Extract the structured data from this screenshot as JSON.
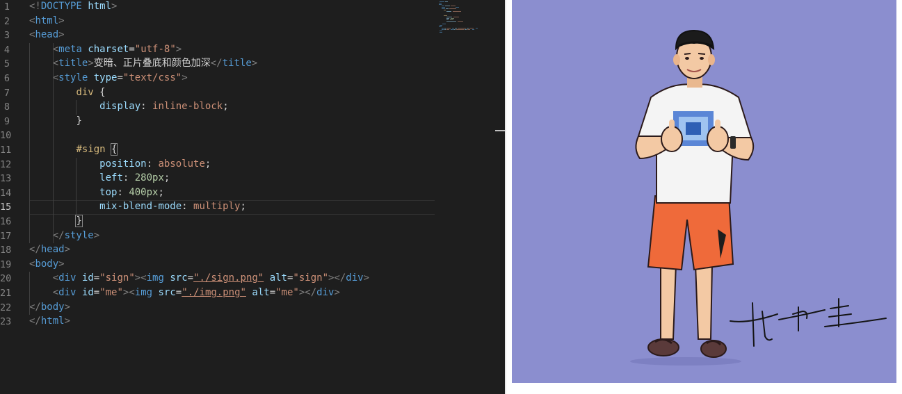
{
  "editor": {
    "active_line": 15,
    "line_numbers": [
      "1",
      "2",
      "3",
      "4",
      "5",
      "6",
      "7",
      "8",
      "9",
      "10",
      "11",
      "12",
      "13",
      "14",
      "15",
      "16",
      "17",
      "18",
      "19",
      "20",
      "21",
      "22",
      "23"
    ],
    "lines": [
      [
        [
          "t-punct",
          "<!"
        ],
        [
          "t-tag",
          "DOCTYPE"
        ],
        [
          "t-text",
          " "
        ],
        [
          "t-attr",
          "html"
        ],
        [
          "t-punct",
          ">"
        ]
      ],
      [
        [
          "t-punct",
          "<"
        ],
        [
          "t-tag",
          "html"
        ],
        [
          "t-punct",
          ">"
        ]
      ],
      [
        [
          "t-punct",
          "<"
        ],
        [
          "t-tag",
          "head"
        ],
        [
          "t-punct",
          ">"
        ]
      ],
      [
        [
          "t-text",
          "    "
        ],
        [
          "t-punct",
          "<"
        ],
        [
          "t-tag",
          "meta"
        ],
        [
          "t-text",
          " "
        ],
        [
          "t-attr",
          "charset"
        ],
        [
          "t-text",
          "="
        ],
        [
          "t-str",
          "\"utf-8\""
        ],
        [
          "t-punct",
          ">"
        ]
      ],
      [
        [
          "t-text",
          "    "
        ],
        [
          "t-punct",
          "<"
        ],
        [
          "t-tag",
          "title"
        ],
        [
          "t-punct",
          ">"
        ],
        [
          "t-text cjk",
          "变暗、正片叠底和颜色加深"
        ],
        [
          "t-punct",
          "</"
        ],
        [
          "t-tag",
          "title"
        ],
        [
          "t-punct",
          ">"
        ]
      ],
      [
        [
          "t-text",
          "    "
        ],
        [
          "t-punct",
          "<"
        ],
        [
          "t-tag",
          "style"
        ],
        [
          "t-text",
          " "
        ],
        [
          "t-attr",
          "type"
        ],
        [
          "t-text",
          "="
        ],
        [
          "t-str",
          "\"text/css\""
        ],
        [
          "t-punct",
          ">"
        ]
      ],
      [
        [
          "t-text",
          "        "
        ],
        [
          "t-sel",
          "div"
        ],
        [
          "t-brace",
          " {"
        ]
      ],
      [
        [
          "t-text",
          "            "
        ],
        [
          "t-prop",
          "display"
        ],
        [
          "t-text",
          ": "
        ],
        [
          "t-val",
          "inline-block"
        ],
        [
          "t-text",
          ";"
        ]
      ],
      [
        [
          "t-text",
          "        "
        ],
        [
          "t-brace",
          "}"
        ]
      ],
      [],
      [
        [
          "t-text",
          "        "
        ],
        [
          "t-sel",
          "#sign"
        ],
        [
          "t-text",
          " "
        ],
        [
          "t-brace bracket-match",
          "{"
        ]
      ],
      [
        [
          "t-text",
          "            "
        ],
        [
          "t-prop",
          "position"
        ],
        [
          "t-text",
          ": "
        ],
        [
          "t-val",
          "absolute"
        ],
        [
          "t-text",
          ";"
        ]
      ],
      [
        [
          "t-text",
          "            "
        ],
        [
          "t-prop",
          "left"
        ],
        [
          "t-text",
          ": "
        ],
        [
          "t-num",
          "280px"
        ],
        [
          "t-text",
          ";"
        ]
      ],
      [
        [
          "t-text",
          "            "
        ],
        [
          "t-prop",
          "top"
        ],
        [
          "t-text",
          ": "
        ],
        [
          "t-num",
          "400px"
        ],
        [
          "t-text",
          ";"
        ]
      ],
      [
        [
          "t-text",
          "            "
        ],
        [
          "t-prop",
          "mix-blend-mode"
        ],
        [
          "t-text",
          ": "
        ],
        [
          "t-val",
          "multiply"
        ],
        [
          "t-text",
          ";"
        ]
      ],
      [
        [
          "t-text",
          "        "
        ],
        [
          "t-brace bracket-match",
          "}"
        ]
      ],
      [
        [
          "t-text",
          "    "
        ],
        [
          "t-punct",
          "</"
        ],
        [
          "t-tag",
          "style"
        ],
        [
          "t-punct",
          ">"
        ]
      ],
      [
        [
          "t-punct",
          "</"
        ],
        [
          "t-tag",
          "head"
        ],
        [
          "t-punct",
          ">"
        ]
      ],
      [
        [
          "t-punct",
          "<"
        ],
        [
          "t-tag",
          "body"
        ],
        [
          "t-punct",
          ">"
        ]
      ],
      [
        [
          "t-text",
          "    "
        ],
        [
          "t-punct",
          "<"
        ],
        [
          "t-tag",
          "div"
        ],
        [
          "t-text",
          " "
        ],
        [
          "t-attr",
          "id"
        ],
        [
          "t-text",
          "="
        ],
        [
          "t-str",
          "\"sign\""
        ],
        [
          "t-punct",
          "><"
        ],
        [
          "t-tag",
          "img"
        ],
        [
          "t-text",
          " "
        ],
        [
          "t-attr",
          "src"
        ],
        [
          "t-text",
          "="
        ],
        [
          "t-str t-link",
          "\"./sign.png\""
        ],
        [
          "t-text",
          " "
        ],
        [
          "t-attr",
          "alt"
        ],
        [
          "t-text",
          "="
        ],
        [
          "t-str",
          "\"sign\""
        ],
        [
          "t-punct",
          "></"
        ],
        [
          "t-tag",
          "div"
        ],
        [
          "t-punct",
          ">"
        ]
      ],
      [
        [
          "t-text",
          "    "
        ],
        [
          "t-punct",
          "<"
        ],
        [
          "t-tag",
          "div"
        ],
        [
          "t-text",
          " "
        ],
        [
          "t-attr",
          "id"
        ],
        [
          "t-text",
          "="
        ],
        [
          "t-str",
          "\"me\""
        ],
        [
          "t-punct",
          "><"
        ],
        [
          "t-tag",
          "img"
        ],
        [
          "t-text",
          " "
        ],
        [
          "t-attr",
          "src"
        ],
        [
          "t-text",
          "="
        ],
        [
          "t-str t-link",
          "\"./img.png\""
        ],
        [
          "t-text",
          " "
        ],
        [
          "t-attr",
          "alt"
        ],
        [
          "t-text",
          "="
        ],
        [
          "t-str",
          "\"me\""
        ],
        [
          "t-punct",
          "></"
        ],
        [
          "t-tag",
          "div"
        ],
        [
          "t-punct",
          ">"
        ]
      ],
      [
        [
          "t-punct",
          "</"
        ],
        [
          "t-tag",
          "body"
        ],
        [
          "t-punct",
          ">"
        ]
      ],
      [
        [
          "t-punct",
          "</"
        ],
        [
          "t-tag",
          "html"
        ],
        [
          "t-punct",
          ">"
        ]
      ]
    ]
  },
  "colors": {
    "editor_bg": "#1e1e1e",
    "preview_bg": "#8b8ecf",
    "shirt": "#f4f4f4",
    "shorts": "#ef6a3a",
    "straps": "#e8612e",
    "skin": "#f3c9a4",
    "cap": "#1b1b1b"
  },
  "preview": {
    "image_alt": "me",
    "signature_alt": "sign"
  }
}
